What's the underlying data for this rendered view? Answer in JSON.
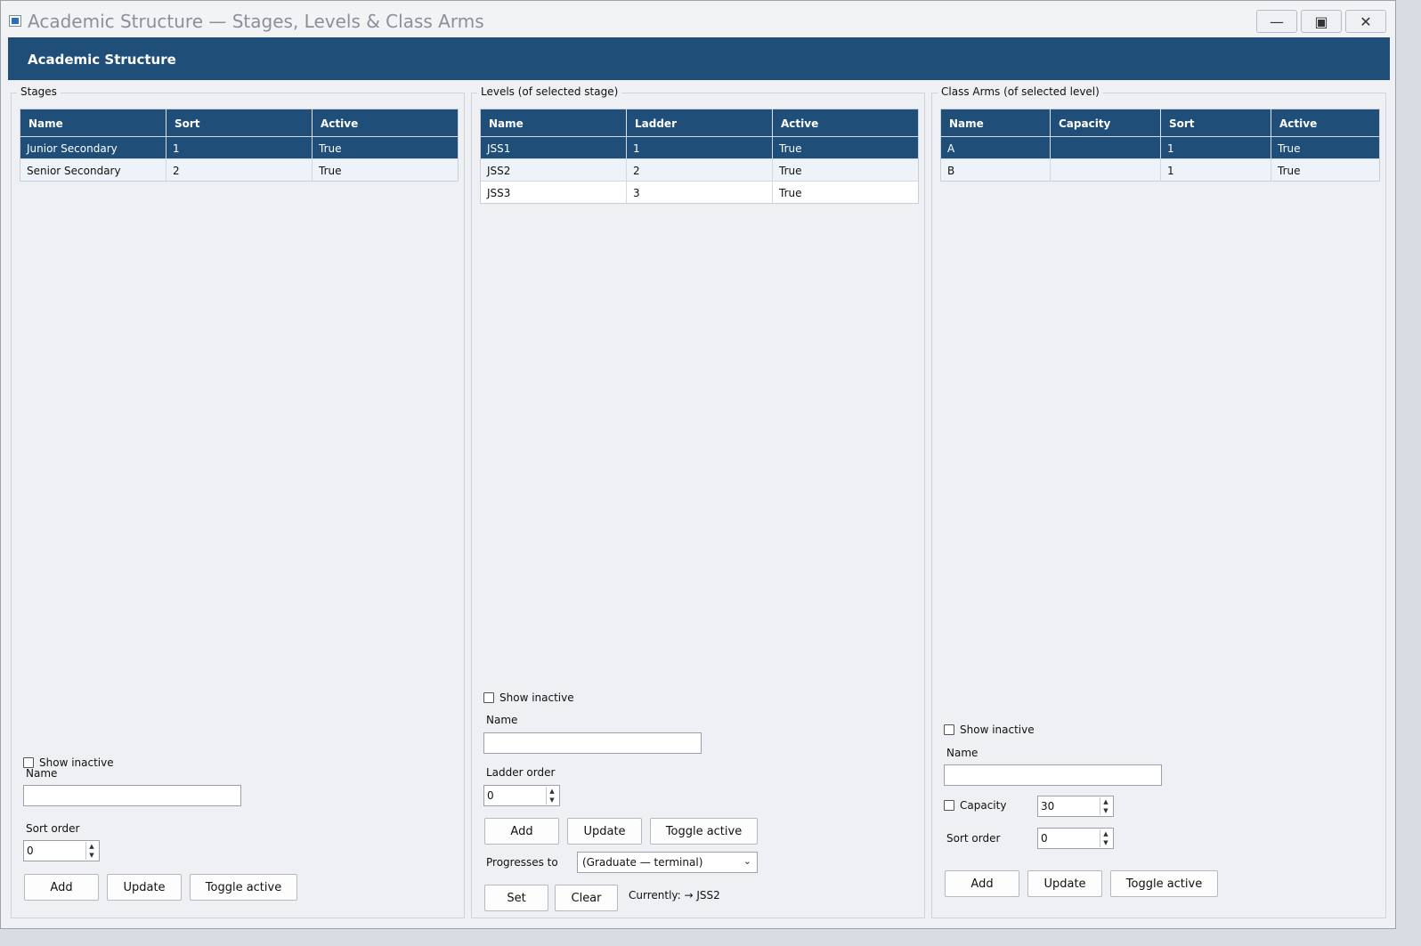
{
  "window": {
    "title": "Academic Structure — Stages, Levels & Class Arms",
    "minimize_icon": "minimize-icon",
    "maximize_icon": "maximize-icon",
    "close_icon": "close-icon"
  },
  "banner": {
    "title": "Academic Structure"
  },
  "stages": {
    "group_title": "Stages",
    "columns": [
      "Name",
      "Sort",
      "Active"
    ],
    "rows": [
      [
        "Junior Secondary",
        "1",
        "True"
      ],
      [
        "Senior Secondary",
        "2",
        "True"
      ]
    ],
    "selected_row": 0,
    "show_inactive_label": "Show inactive",
    "name_label": "Name",
    "name_value": "",
    "sort_label": "Sort order",
    "sort_value": "0",
    "add_label": "Add",
    "update_label": "Update",
    "toggle_label": "Toggle active"
  },
  "levels": {
    "group_title": "Levels (of selected stage)",
    "columns": [
      "Name",
      "Ladder",
      "Active"
    ],
    "rows": [
      [
        "JSS1",
        "1",
        "True"
      ],
      [
        "JSS2",
        "2",
        "True"
      ],
      [
        "JSS3",
        "3",
        "True"
      ]
    ],
    "selected_row": 0,
    "show_inactive_label": "Show inactive",
    "name_label": "Name",
    "name_value": "",
    "ladder_label": "Ladder order",
    "ladder_value": "0",
    "add_label": "Add",
    "update_label": "Update",
    "toggle_label": "Toggle active",
    "progresses_label": "Progresses to",
    "progresses_value": "(Graduate — terminal)",
    "set_label": "Set",
    "clear_label": "Clear",
    "currently_text": "Currently: → JSS2"
  },
  "arms": {
    "group_title": "Class Arms (of selected level)",
    "columns": [
      "Name",
      "Capacity",
      "Sort",
      "Active"
    ],
    "rows": [
      [
        "A",
        "",
        "1",
        "True"
      ],
      [
        "B",
        "",
        "1",
        "True"
      ]
    ],
    "selected_row": 0,
    "show_inactive_label": "Show inactive",
    "name_label": "Name",
    "name_value": "",
    "capacity_label": "Capacity",
    "capacity_value": "30",
    "sort_label": "Sort order",
    "sort_value": "0",
    "add_label": "Add",
    "update_label": "Update",
    "toggle_label": "Toggle active"
  },
  "colors": {
    "header_bg": "#1f4e79",
    "row_alt": "#eef3f9"
  }
}
